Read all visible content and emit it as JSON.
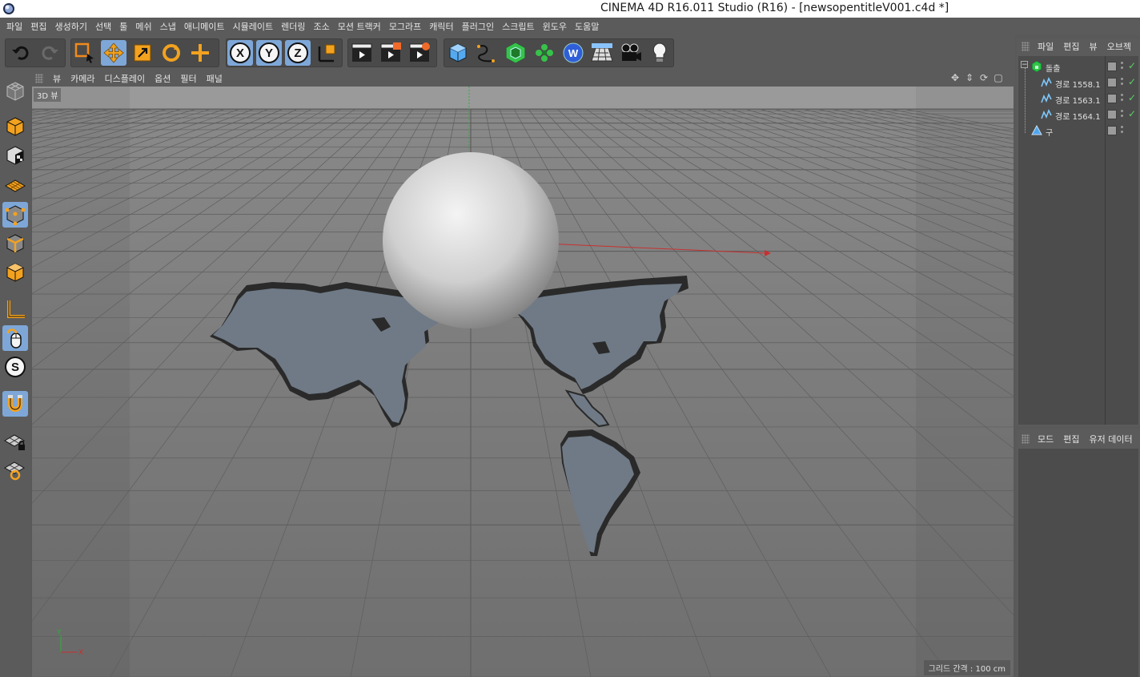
{
  "window": {
    "title": "CINEMA 4D R16.011 Studio (R16) - [newsopentitleV001.c4d *]"
  },
  "menubar": {
    "items": [
      "파일",
      "편집",
      "생성하기",
      "선택",
      "툴",
      "메쉬",
      "스냅",
      "애니메이트",
      "시뮬레이트",
      "렌더링",
      "조소",
      "모션 트랙커",
      "모그라프",
      "캐릭터",
      "플러그인",
      "스크립트",
      "윈도우",
      "도움말"
    ]
  },
  "toolbar": {
    "groups": [
      {
        "icons": [
          "undo-icon",
          "redo-icon"
        ]
      },
      {
        "icons": [
          "live-selection-icon",
          "move-icon",
          "scale-icon",
          "rotate-icon",
          "last-tool-icon"
        ]
      },
      {
        "icons": [
          "x-axis-lock-icon",
          "y-axis-lock-icon",
          "z-axis-lock-icon",
          "coordinate-system-icon"
        ]
      },
      {
        "icons": [
          "render-view-icon",
          "render-picture-viewer-icon",
          "edit-render-settings-icon"
        ]
      },
      {
        "icons": [
          "cube-primitive-icon",
          "spline-pen-icon",
          "subdivision-generator-icon",
          "cloner-icon",
          "deformer-icon",
          "floor-icon",
          "camera-icon",
          "light-icon"
        ]
      }
    ],
    "axis_labels": [
      "X",
      "Y",
      "Z"
    ],
    "deformer_label": "W"
  },
  "leftbar": {
    "icons": [
      "make-editable-icon",
      "model-mode-icon",
      "texture-mode-icon",
      "workplane-mode-icon",
      "points-mode-icon",
      "edges-mode-icon",
      "polygons-mode-icon",
      "axis-mode-icon",
      "tweak-mode-icon",
      "solo-mode-icon",
      "snap-magnet-icon",
      "workplane-lock-icon",
      "locked-workplane-icon"
    ],
    "solo_label": "S"
  },
  "viewport": {
    "menu": [
      "뷰",
      "카메라",
      "디스플레이",
      "옵션",
      "필터",
      "패널"
    ],
    "view_label": "3D 뷰",
    "grid_label": "그리드 간격 : 100 cm",
    "axis_gizmo": {
      "x": "X",
      "y": "Y"
    },
    "colors": {
      "background": "#7b7b7b",
      "grid_line": "#5e5e5e",
      "x_axis": "#c83030",
      "y_axis": "#2fae3a",
      "map": "#6f7a86",
      "map_edge": "#2a2a2a"
    }
  },
  "objects_panel": {
    "menu": [
      "파일",
      "편집",
      "뷰",
      "오브젝"
    ],
    "items": [
      {
        "name": "돌출",
        "icon": "extrude-icon",
        "level": 0,
        "checked": true
      },
      {
        "name": "경로 1558.1",
        "icon": "spline-icon",
        "level": 1,
        "checked": true
      },
      {
        "name": "경로 1563.1",
        "icon": "spline-icon",
        "level": 1,
        "checked": true
      },
      {
        "name": "경로 1564.1",
        "icon": "spline-icon",
        "level": 1,
        "checked": true
      },
      {
        "name": "구",
        "icon": "sphere-icon",
        "level": 0,
        "checked": false
      }
    ]
  },
  "attributes_panel": {
    "menu": [
      "모드",
      "편집",
      "유저 데이터"
    ]
  }
}
